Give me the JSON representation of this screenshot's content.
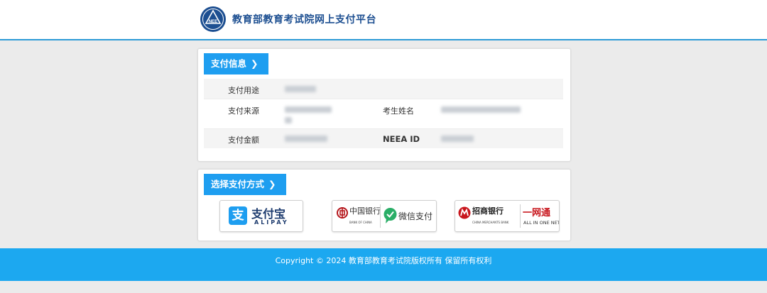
{
  "header": {
    "site_title": "教育部教育考试院网上支付平台",
    "logo_letters": "NEEA"
  },
  "payment_info": {
    "section_title": "支付信息",
    "rows": [
      {
        "label": "支付用途"
      },
      {
        "label": "支付来源",
        "label2": "考生姓名"
      },
      {
        "label": "支付金额",
        "label2": "NEEA ID"
      }
    ]
  },
  "payment_method": {
    "section_title": "选择支付方式",
    "alipay": {
      "brand": "支付宝",
      "sub": "ALIPAY",
      "glyph": "支"
    },
    "boc_wechat": {
      "bank_cn": "中国银行",
      "bank_en": "BANK OF CHINA",
      "wechat": "微信支付"
    },
    "cmb": {
      "bank_cn": "招商银行",
      "bank_en": "CHINA MERCHANTS BANK",
      "net_cn": "一网通",
      "net_en": "ALL IN ONE NET"
    }
  },
  "footer": {
    "copyright": "Copyright © 2024 教育部教育考试院版权所有 保留所有权利"
  },
  "colors": {
    "accent": "#1e9ef0",
    "footer": "#1ca8f0",
    "header_line": "#2d9bd6",
    "title": "#1d4f91"
  }
}
